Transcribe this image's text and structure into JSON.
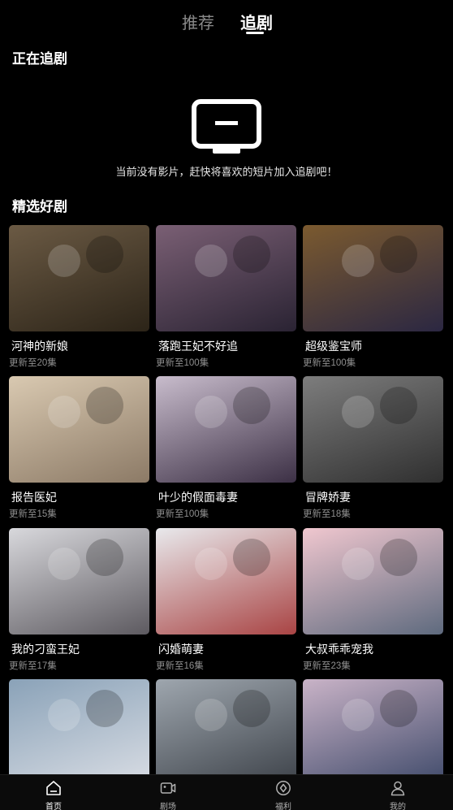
{
  "top_tabs": {
    "recommend": "推荐",
    "following": "追剧"
  },
  "sections": {
    "following": "正在追剧",
    "picks": "精选好剧"
  },
  "empty_state": {
    "icon": "tv-icon",
    "text": "当前没有影片，赶快将喜欢的短片加入追剧吧！"
  },
  "dramas": [
    {
      "title": "河神的新娘",
      "update": "更新至20集",
      "colors": [
        "#6b5a44",
        "#2c2418"
      ]
    },
    {
      "title": "落跑王妃不好追",
      "update": "更新至100集",
      "colors": [
        "#7a5f74",
        "#2a2333"
      ]
    },
    {
      "title": "超级鉴宝师",
      "update": "更新至100集",
      "colors": [
        "#7b5a2f",
        "#2b2742"
      ]
    },
    {
      "title": "报告医妃",
      "update": "更新至15集",
      "colors": [
        "#d9c9b1",
        "#8c7a66"
      ]
    },
    {
      "title": "叶少的假面毒妻",
      "update": "更新至100集",
      "colors": [
        "#c8bccc",
        "#3c3045"
      ]
    },
    {
      "title": "冒牌娇妻",
      "update": "更新至18集",
      "colors": [
        "#7d7d7d",
        "#2f2f2f"
      ]
    },
    {
      "title": "我的刁蛮王妃",
      "update": "更新至17集",
      "colors": [
        "#d8d8dc",
        "#5d5a60"
      ]
    },
    {
      "title": "闪婚萌妻",
      "update": "更新至16集",
      "colors": [
        "#e8e9ec",
        "#a94444"
      ]
    },
    {
      "title": "大叔乖乖宠我",
      "update": "更新至23集",
      "colors": [
        "#f0c7cf",
        "#5e6a7e"
      ]
    },
    {
      "title": "",
      "update": "",
      "colors": [
        "#8aa2b8",
        "#d9dde4"
      ]
    },
    {
      "title": "",
      "update": "",
      "colors": [
        "#9ea6ae",
        "#3d4249"
      ]
    },
    {
      "title": "",
      "update": "",
      "colors": [
        "#c9b3c7",
        "#3f4a6a"
      ]
    }
  ],
  "bottom_nav": [
    {
      "label": "首页",
      "icon": "home-icon",
      "active": true
    },
    {
      "label": "剧场",
      "icon": "video-camera-icon",
      "active": false
    },
    {
      "label": "福利",
      "icon": "welfare-icon",
      "active": false
    },
    {
      "label": "我的",
      "icon": "user-icon",
      "active": false
    }
  ],
  "colors": {
    "background": "#000000",
    "text": "#ffffff",
    "muted": "#8e8e8e"
  }
}
